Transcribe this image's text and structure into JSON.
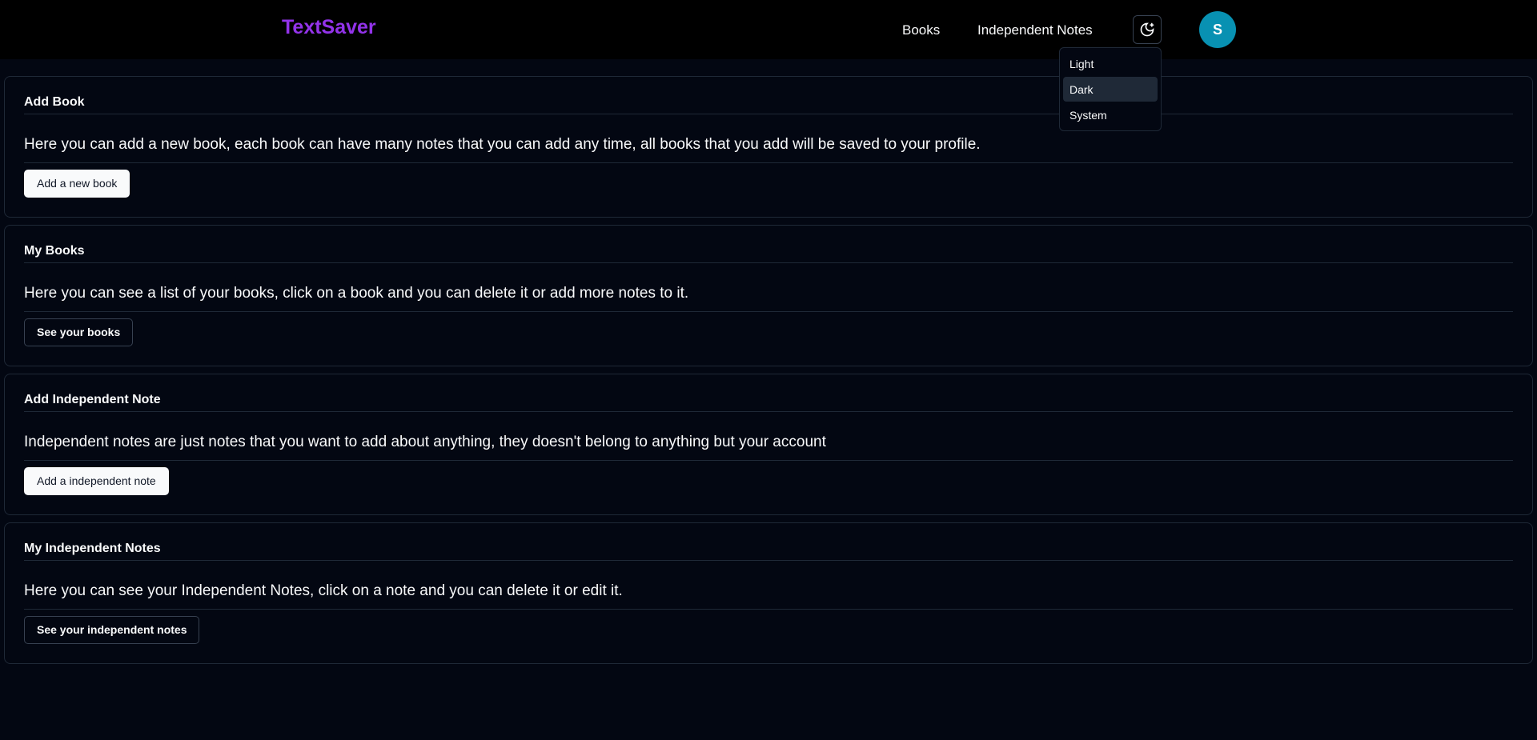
{
  "navbar": {
    "brand": "TextSaver",
    "links": [
      "Books",
      "Independent Notes"
    ],
    "theme_icon": "moon-sun-icon",
    "avatar_initial": "S",
    "brand_color": "#9333ea",
    "avatar_color": "#0891b2"
  },
  "theme_menu": {
    "options": [
      "Light",
      "Dark",
      "System"
    ],
    "selected": "Dark"
  },
  "cards": [
    {
      "title": "Add Book",
      "description": "Here you can add a new book, each book can have many notes that you can add any time, all books that you add will be saved to your profile.",
      "button": "Add a new book"
    },
    {
      "title": "My Books",
      "description": "Here you can see a list of your books, click on a book and you can delete it or add more notes to it.",
      "button": "See your books"
    },
    {
      "title": "Add Independent Note",
      "description": "Independent notes are just notes that you want to add about anything, they doesn't belong to anything but your account",
      "button": "Add a independent note"
    },
    {
      "title": "My Independent Notes",
      "description": "Here you can see your Independent Notes, click on a note and you can delete it or edit it.",
      "button": "See your independent notes"
    }
  ]
}
